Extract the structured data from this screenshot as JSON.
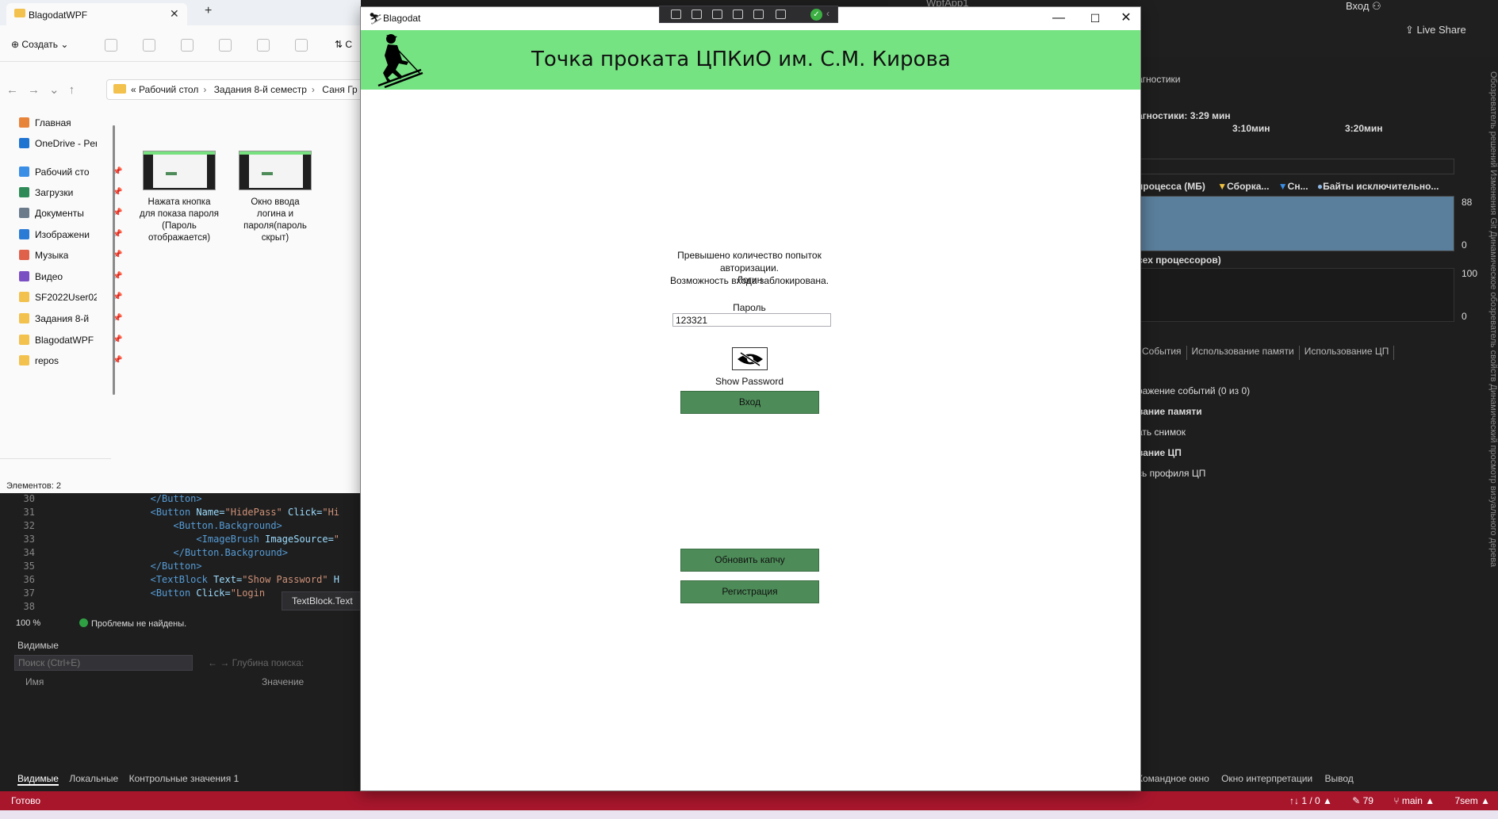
{
  "vs": {
    "project_title": "WpfApp1",
    "signin": "Вход",
    "live_share": "Live Share",
    "diagnostics": {
      "title": "агностики",
      "session_time": "агностики: 3:29 мин",
      "ticks": [
        "3:10мин",
        "3:20мин"
      ],
      "legend": [
        "процесса (МБ)",
        "Сборка...",
        "Сн...",
        "Байты исключительно..."
      ],
      "mem_max": "88",
      "mem_min": "0",
      "cpu_title": "сех процессоров)",
      "cpu_max": "100",
      "cpu_min": "0",
      "tabs": [
        "События",
        "Использование памяти",
        "Использование ЦП"
      ],
      "items": [
        "ражение событий (0 из 0)",
        "вание памяти",
        "ать снимок",
        "вание ЦП",
        "сь профиля ЦП"
      ]
    },
    "right_vertical": "Обозреватель решений   Изменения Git   Динамическое обозреватель свойств   Динамический просмотр визуального дерева",
    "bottom_tabs_right": [
      "Командное окно",
      "Окно интерпретации",
      "Вывод"
    ],
    "code": {
      "lines": [
        {
          "n": "30",
          "html_parts": [
            [
              "txt",
              "                "
            ],
            [
              "tag",
              "</Button>"
            ]
          ]
        },
        {
          "n": "31",
          "html_parts": [
            [
              "txt",
              "                "
            ],
            [
              "tag",
              "<Button "
            ],
            [
              "attr",
              "Name="
            ],
            [
              "str",
              "\"HidePass\" "
            ],
            [
              "attr",
              "Click="
            ],
            [
              "str",
              "\"Hi"
            ]
          ]
        },
        {
          "n": "32",
          "html_parts": [
            [
              "txt",
              "                    "
            ],
            [
              "tag",
              "<Button.Background>"
            ]
          ]
        },
        {
          "n": "33",
          "html_parts": [
            [
              "txt",
              "                        "
            ],
            [
              "tag",
              "<ImageBrush "
            ],
            [
              "attr",
              "ImageSource="
            ],
            [
              "str",
              "\""
            ]
          ]
        },
        {
          "n": "34",
          "html_parts": [
            [
              "txt",
              "                    "
            ],
            [
              "tag",
              "</Button.Background>"
            ]
          ]
        },
        {
          "n": "35",
          "html_parts": [
            [
              "txt",
              "                "
            ],
            [
              "tag",
              "</Button>"
            ]
          ]
        },
        {
          "n": "36",
          "html_parts": [
            [
              "txt",
              "                "
            ],
            [
              "tag",
              "<TextBlock "
            ],
            [
              "attr",
              "Text="
            ],
            [
              "str",
              "\"Show Password\" "
            ],
            [
              "attr",
              "H"
            ]
          ]
        },
        {
          "n": "37",
          "html_parts": [
            [
              "txt",
              "                "
            ],
            [
              "tag",
              "<Button "
            ],
            [
              "attr",
              "Click="
            ],
            [
              "str",
              "\"Login"
            ]
          ]
        },
        {
          "n": "38",
          "html_parts": [
            [
              "txt",
              ""
            ]
          ]
        }
      ],
      "tooltip": "TextBlock.Text",
      "zoom": "100 %",
      "problems": "Проблемы не найдены."
    },
    "watch": {
      "title": "Видимые",
      "search_placeholder": "Поиск (Ctrl+E)",
      "depth_label": "Глубина поиска:",
      "col_name": "Имя",
      "col_value": "Значение",
      "tabs": [
        "Видимые",
        "Локальные",
        "Контрольные значения 1"
      ]
    },
    "status": {
      "ready": "Готово",
      "items": [
        "↑↓ 1 / 0 ▲",
        "✎ 79",
        "⑂ main ▲",
        "7sem ▲"
      ]
    }
  },
  "explorer": {
    "tab_title": "BlagodatWPF",
    "create_label": "Создать",
    "sort_label": "С",
    "path": [
      "Рабочий стол",
      "Задания 8-й семестр",
      "Саня Гр"
    ],
    "sidebar": [
      {
        "label": "Главная",
        "icon": "home-icon",
        "color": "#e8833a",
        "pin": false
      },
      {
        "label": "OneDrive - Perso",
        "icon": "cloud-icon",
        "color": "#1f74d1",
        "pin": false
      },
      {
        "label": "Рабочий сто",
        "icon": "desktop-icon",
        "color": "#3a8ee6",
        "pin": true
      },
      {
        "label": "Загрузки",
        "icon": "download-icon",
        "color": "#2e8b57",
        "pin": true
      },
      {
        "label": "Документы",
        "icon": "document-icon",
        "color": "#6b7b8c",
        "pin": true
      },
      {
        "label": "Изображени",
        "icon": "image-icon",
        "color": "#2a7bd5",
        "pin": true
      },
      {
        "label": "Музыка",
        "icon": "music-icon",
        "color": "#e0614a",
        "pin": true
      },
      {
        "label": "Видео",
        "icon": "video-icon",
        "color": "#7b4fc4",
        "pin": true
      },
      {
        "label": "SF2022User02",
        "icon": "folder-icon",
        "color": "#f2c14e",
        "pin": true
      },
      {
        "label": "Задания 8-й",
        "icon": "folder-icon",
        "color": "#f2c14e",
        "pin": true
      },
      {
        "label": "BlagodatWPF",
        "icon": "folder-icon",
        "color": "#f2c14e",
        "pin": true
      },
      {
        "label": "repos",
        "icon": "folder-icon",
        "color": "#f2c14e",
        "pin": true
      }
    ],
    "files": [
      {
        "name": "Нажата кнопка для показа пароля (Пароль отображается)"
      },
      {
        "name": "Окно ввода логина и пароля(пароль скрыт)"
      }
    ],
    "count": "Элементов: 2"
  },
  "app": {
    "window_title": "Blagodat",
    "heading": "Точка проката ЦПКиО им. С.М. Кирова",
    "error_lines": [
      "Превышено количество попыток авторизации.",
      "Возможность входа заблокирована."
    ],
    "login_label": "Логин",
    "password_label": "Пароль",
    "password_value": "123321",
    "show_password_label": "Show Password",
    "login_button": "Вход",
    "captcha_button": "Обновить капчу",
    "register_button": "Регистрация"
  }
}
